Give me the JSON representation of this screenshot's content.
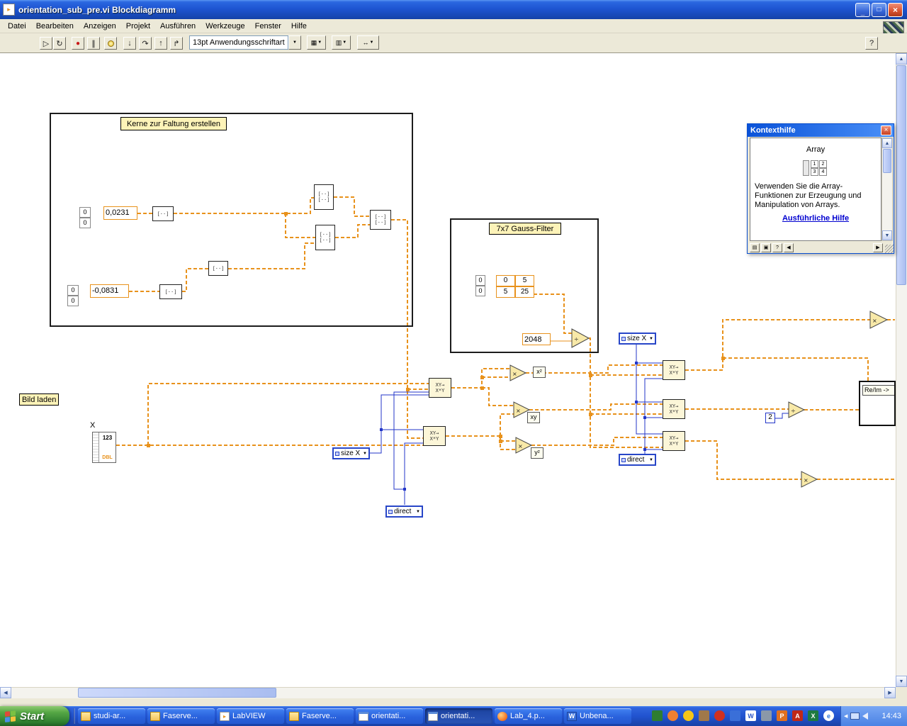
{
  "titlebar": {
    "title": "orientation_sub_pre.vi Blockdiagramm"
  },
  "menubar": {
    "items": [
      "Datei",
      "Bearbeiten",
      "Anzeigen",
      "Projekt",
      "Ausführen",
      "Werkzeuge",
      "Fenster",
      "Hilfe"
    ]
  },
  "toolbar": {
    "font_selector": "13pt Anwendungsschriftart"
  },
  "icons": {
    "minimize": "_",
    "maximize": "□",
    "close": "×",
    "run": "▷",
    "run_continuous": "↻",
    "abort": "●",
    "pause": "∥",
    "step_into": "↓",
    "step_over": "↷",
    "step_out": "↑",
    "step_out2": "↱",
    "dropdown": "▼",
    "up": "▲",
    "down": "▼",
    "left": "◀",
    "right": "▶",
    "help": "?",
    "multiply": "×",
    "divide": "÷",
    "align": "▦",
    "distribute": "▥",
    "resize": "↔",
    "lv_arrow": "▸",
    "word": "W",
    "excel": "X",
    "ppt": "P",
    "acrobat": "A",
    "ie": "e",
    "chevron": "◀",
    "ctx_watch": "▤",
    "ctx_lock": "▣",
    "ctx_help": "?"
  },
  "diagram": {
    "frames": {
      "kernel": {
        "label": "Kerne zur Faltung erstellen"
      },
      "gauss": {
        "label": "7x7 Gauss-Filter"
      }
    },
    "labels": {
      "bild_laden": "Bild laden",
      "x_control": "X"
    },
    "constants": {
      "zero": "0",
      "c1": "0,0231",
      "c2": "-0,0831",
      "c2048": "2048",
      "c2s": "2"
    },
    "gauss_matrix": {
      "r1c1": "0",
      "r1c2": "5",
      "r2c1": "5",
      "r2c2": "25"
    },
    "enums": {
      "size_x": "size X",
      "direct": "direct"
    },
    "op_labels": {
      "x2": "x²",
      "xy": "xy",
      "y2": "y²"
    },
    "re_im": "Re/Im ->",
    "x_icon": {
      "digits": "123",
      "type": "DBL"
    },
    "node_glyphs": {
      "row": "[··]",
      "xy1": "XY→",
      "xy2": "X*Y"
    }
  },
  "context_help": {
    "title": "Kontexthilfe",
    "heading": "Array",
    "body": "Verwenden Sie die Array-Funktionen zur Erzeugung und Manipulation von Arrays.",
    "link": "Ausführliche Hilfe",
    "icon": {
      "c1": "1",
      "c2": "2",
      "c3": "3",
      "c4": "4"
    }
  },
  "taskbar": {
    "start": "Start",
    "items": [
      {
        "label": "studi-ar..."
      },
      {
        "label": "Faserve..."
      },
      {
        "label": "LabVIEW"
      },
      {
        "label": "Faserve..."
      },
      {
        "label": "orientati..."
      },
      {
        "label": "orientati..."
      },
      {
        "label": "Lab_4.p..."
      },
      {
        "label": "Unbena..."
      }
    ],
    "clock": "14:43"
  }
}
